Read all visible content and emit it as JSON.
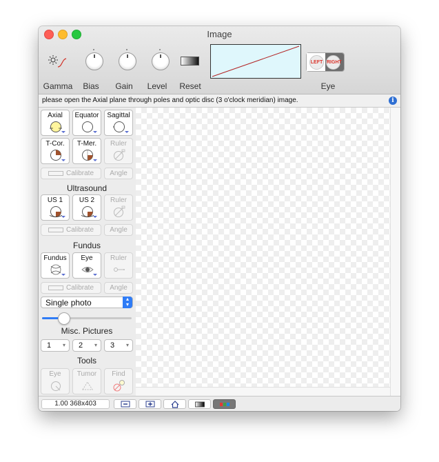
{
  "window": {
    "title": "Image"
  },
  "toolbar": {
    "gamma_label": "Gamma",
    "bias_label": "Bias",
    "gain_label": "Gain",
    "level_label": "Level",
    "reset_label": "Reset",
    "eye_label": "Eye",
    "eye_left": "LEFT",
    "eye_right": "RIGHT"
  },
  "info": {
    "message": "please open the Axial plane through poles and optic disc (3 o'clock meridian) image.",
    "icon": "info-icon"
  },
  "sidebar": {
    "views": [
      "Axial",
      "Equator",
      "Sagittal",
      "T-Cor.",
      "T-Mer.",
      "Ruler"
    ],
    "calibrate": "Calibrate",
    "angle": "Angle",
    "ultrasound_title": "Ultrasound",
    "ultrasound": [
      "US 1",
      "US 2",
      "Ruler"
    ],
    "fundus_title": "Fundus",
    "fundus": [
      "Fundus",
      "Eye",
      "Ruler"
    ],
    "photo_select": "Single photo",
    "slider_value": 0.24,
    "misc_title": "Misc. Pictures",
    "misc": [
      "1",
      "2",
      "3"
    ],
    "tools_title": "Tools",
    "tools": [
      "Eye",
      "Tumor",
      "Find"
    ]
  },
  "status": {
    "zoom_text": "1.00 368x403"
  },
  "colors": {
    "accent": "#2f7cf6",
    "preview_bg": "#dff7fc",
    "preview_line": "#b22222",
    "info": "#2f6fd3"
  }
}
